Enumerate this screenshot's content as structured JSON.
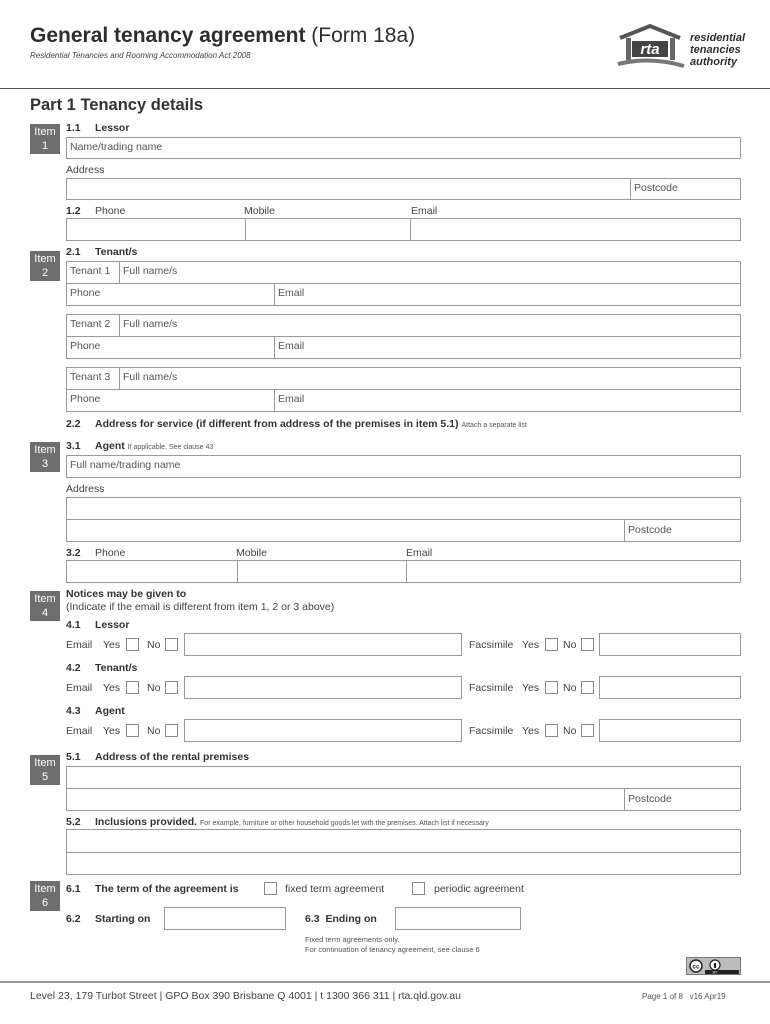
{
  "header": {
    "title_bold": "General tenancy agreement",
    "title_normal": "(Form 18a)",
    "subtitle": "Residential Tenancies and Rooming Accommodation Act 2008",
    "logo": {
      "mark": "rta",
      "lines": [
        "residential",
        "tenancies",
        "authority"
      ]
    }
  },
  "part_title": "Part 1 Tenancy details",
  "item_word": "Item",
  "item1": {
    "num": "1",
    "s11": {
      "num": "1.1",
      "label": "Lessor"
    },
    "name_label": "Name/trading name",
    "address_label": "Address",
    "postcode_label": "Postcode",
    "s12": {
      "num": "1.2"
    },
    "phone_label": "Phone",
    "mobile_label": "Mobile",
    "email_label": "Email"
  },
  "item2": {
    "num": "2",
    "s21": {
      "num": "2.1",
      "label": "Tenant/s"
    },
    "tenants": [
      {
        "label": "Tenant 1",
        "name_label": "Full name/s",
        "phone_label": "Phone",
        "email_label": "Email"
      },
      {
        "label": "Tenant 2",
        "name_label": "Full name/s",
        "phone_label": "Phone",
        "email_label": "Email"
      },
      {
        "label": "Tenant 3",
        "name_label": "Full name/s",
        "phone_label": "Phone",
        "email_label": "Email"
      }
    ],
    "s22": {
      "num": "2.2",
      "label": "Address for service (if different from address of the premises in item 5.1)",
      "note": "Attach a separate list"
    }
  },
  "item3": {
    "num": "3",
    "s31": {
      "num": "3.1",
      "label": "Agent",
      "note": "If applicable. See clause 43"
    },
    "name_label": "Full name/trading name",
    "address_label": "Address",
    "postcode_label": "Postcode",
    "s32": {
      "num": "3.2"
    },
    "phone_label": "Phone",
    "mobile_label": "Mobile",
    "email_label": "Email"
  },
  "item4": {
    "num": "4",
    "heading": "Notices may be given to",
    "subheading": "(Indicate if the email is different from item 1, 2 or 3 above)",
    "rows": [
      {
        "num": "4.1",
        "label": "Lessor"
      },
      {
        "num": "4.2",
        "label": "Tenant/s"
      },
      {
        "num": "4.3",
        "label": "Agent"
      }
    ],
    "email_label": "Email",
    "fax_label": "Facsimile",
    "yes_label": "Yes",
    "no_label": "No"
  },
  "item5": {
    "num": "5",
    "s51": {
      "num": "5.1",
      "label": "Address of the rental premises"
    },
    "postcode_label": "Postcode",
    "s52": {
      "num": "5.2",
      "label": "Inclusions provided.",
      "note": "For example, furniture or other household goods let with the premises. Attach list if necessary"
    }
  },
  "item6": {
    "num": "6",
    "s61": {
      "num": "6.1",
      "label": "The term of the agreement is"
    },
    "opt_fixed": "fixed term agreement",
    "opt_periodic": "periodic agreement",
    "s62": {
      "num": "6.2",
      "label": "Starting on"
    },
    "s63": {
      "num": "6.3",
      "label": "Ending on"
    },
    "note1": "Fixed term agreements only.",
    "note2": "For continuation of tenancy agreement, see clause 6"
  },
  "footer": {
    "address": "Level 23, 179 Turbot Street | GPO Box 390 Brisbane Q 4001 | t 1300 366 311 | rta.qld.gov.au",
    "page": "Page 1 of 8",
    "version": "v16 Apr19",
    "license_badge": "cc-by-icon"
  }
}
